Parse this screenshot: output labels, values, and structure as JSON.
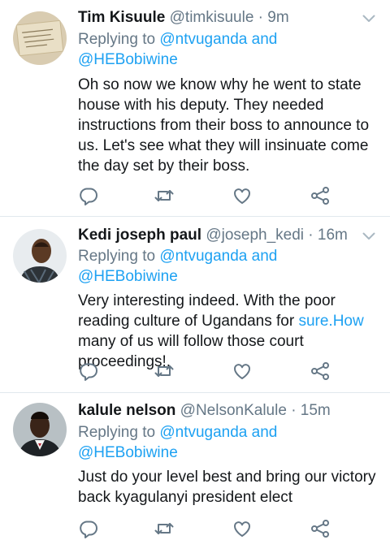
{
  "tweets": [
    {
      "name": "Tim Kisuule",
      "handle": "@timkisuule",
      "dot": "·",
      "time": "9m",
      "replying_prefix": "Replying to",
      "mention1": "@ntvuganda",
      "and_word": "and",
      "mention2": "@HEBobiwine",
      "body": "Oh so now we know why he went to state house with his deputy. They needed instructions from their boss to announce to us. Let's see what they will insinuate come the day set by their boss."
    },
    {
      "name": "Kedi joseph paul",
      "handle": "@joseph_kedi",
      "dot": "·",
      "time": "16m",
      "replying_prefix": "Replying to",
      "mention1": "@ntvuganda",
      "and_word": "and",
      "mention2": "@HEBobiwine",
      "body_before": "Very interesting indeed. With the poor reading culture of Ugandans for ",
      "body_link": "sure.How",
      "body_after": " many of us will follow those court proceedings!."
    },
    {
      "name": "kalule nelson",
      "handle": "@NelsonKalule",
      "dot": "·",
      "time": "15m",
      "replying_prefix": "Replying to",
      "mention1": "@ntvuganda",
      "and_word": "and",
      "mention2": "@HEBobiwine",
      "body": "Just do your level best and bring our victory back kyagulanyi president elect"
    }
  ],
  "colors": {
    "accent": "#1da1f2",
    "muted": "#657786",
    "text": "#14171a",
    "divider": "#e1e8ed"
  },
  "icons": [
    "reply-icon",
    "retweet-icon",
    "like-icon",
    "share-icon",
    "chevron-down-icon"
  ]
}
